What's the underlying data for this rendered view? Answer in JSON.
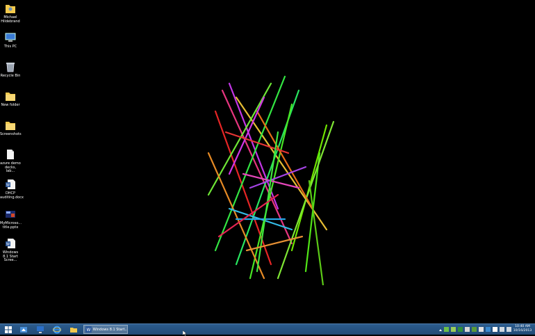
{
  "desktop": {
    "icons": [
      {
        "label": "Michael Hildebrand",
        "icon": "user-folder-icon"
      },
      {
        "label": "This PC",
        "icon": "computer-icon"
      },
      {
        "label": "Recycle Bin",
        "icon": "recycle-bin-icon"
      },
      {
        "label": "New folder",
        "icon": "folder-icon"
      },
      {
        "label": "Screenshots",
        "icon": "folder-icon"
      },
      {
        "label": "azure demo decks, lab...",
        "icon": "document-icon"
      },
      {
        "label": "DHCP auditing.docx",
        "icon": "word-document-icon"
      },
      {
        "label": "MyMicroso... title.pptx",
        "icon": "powerpoint-file-icon"
      },
      {
        "label": "Windows 8.1 Start Scree...",
        "icon": "word-document-icon"
      }
    ]
  },
  "taskbar": {
    "pinned": [
      {
        "name": "start-button",
        "icon": "windows-logo-icon"
      },
      {
        "name": "pinned-app-1",
        "icon": "app-icon"
      },
      {
        "name": "pinned-app-2",
        "icon": "app-icon"
      },
      {
        "name": "internet-explorer",
        "icon": "internet-explorer-icon"
      },
      {
        "name": "file-explorer",
        "icon": "file-explorer-icon"
      }
    ],
    "active_task": {
      "label": "Windows 8.1 Start...",
      "icon": "word-icon"
    },
    "clock": {
      "time": "10:40 AM",
      "date": "10/16/2013"
    }
  }
}
